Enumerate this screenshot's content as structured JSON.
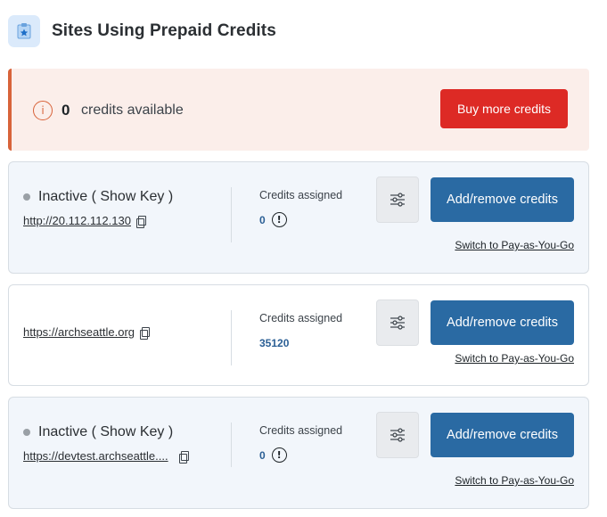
{
  "header": {
    "title": "Sites Using Prepaid Credits",
    "icon": "star-clipboard-icon"
  },
  "banner": {
    "count": "0",
    "text": "credits available",
    "button": "Buy more credits",
    "accent": "#d8633a",
    "button_color": "#dd2a25"
  },
  "sites": [
    {
      "status": "Inactive ( Show Key )",
      "url": "http://20.112.112.130",
      "credits_label": "Credits assigned",
      "credits_value": "0",
      "add_button": "Add/remove credits",
      "switch_link": "Switch to Pay-as-You-Go"
    },
    {
      "status": "",
      "url": "https://archseattle.org",
      "credits_label": "Credits assigned",
      "credits_value": "35120",
      "add_button": "Add/remove credits",
      "switch_link": "Switch to Pay-as-You-Go"
    },
    {
      "status": "Inactive ( Show Key )",
      "url": "https://devtest.archseattle....",
      "credits_label": "Credits assigned",
      "credits_value": "0",
      "add_button": "Add/remove credits",
      "switch_link": "Switch to Pay-as-You-Go"
    }
  ],
  "colors": {
    "primary_button": "#2a6aa3",
    "credits_value": "#2b5f95"
  }
}
